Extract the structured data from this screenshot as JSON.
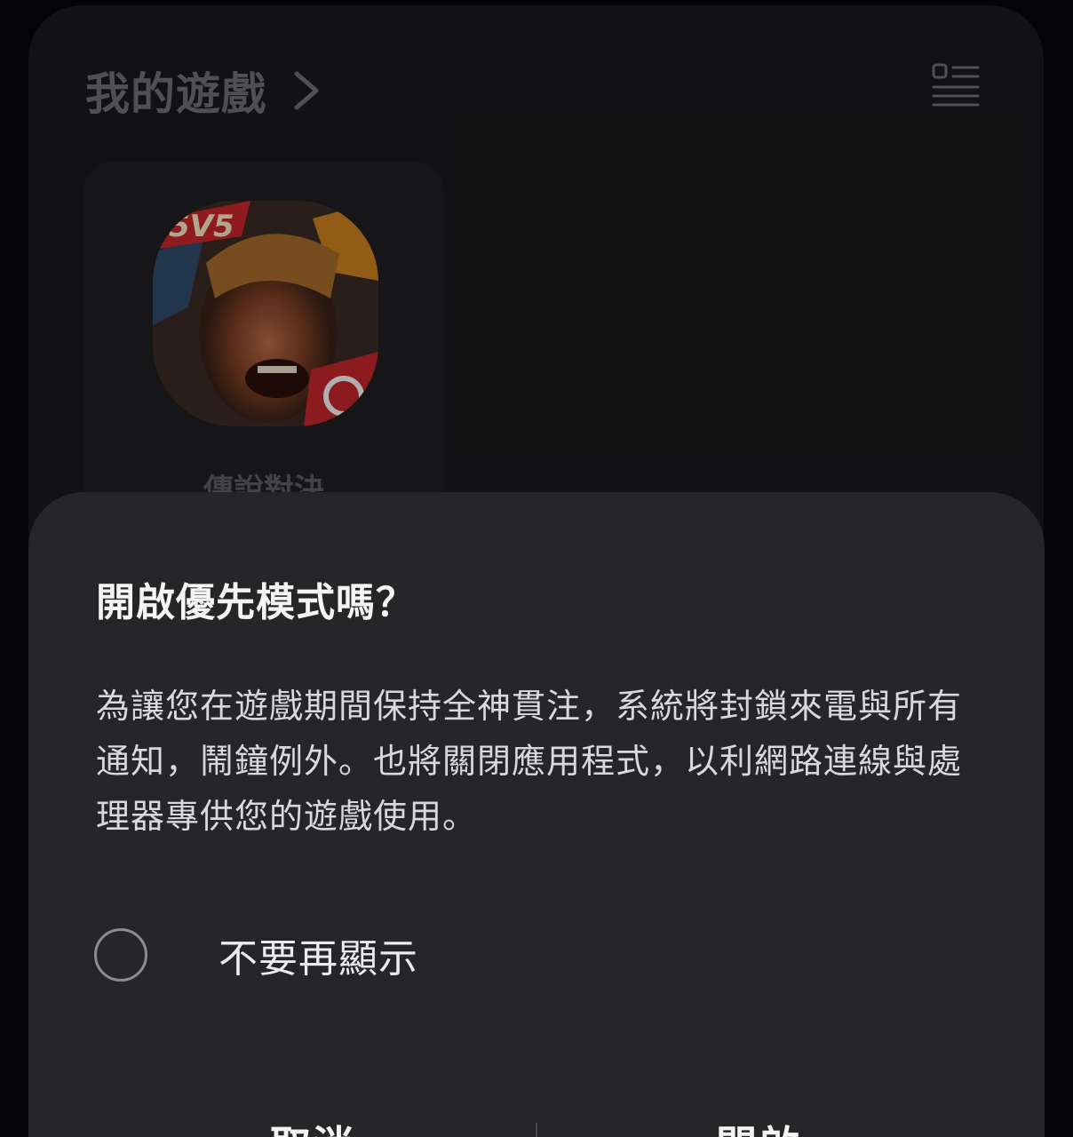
{
  "games_panel": {
    "title": "我的遊戲",
    "chevron_icon": "chevron-right-icon",
    "view_toggle_icon": "list-view-icon",
    "games": [
      {
        "name": "傳說對決",
        "icon": "game-app-icon"
      }
    ]
  },
  "dialog": {
    "title": "開啟優先模式嗎？",
    "body": "為讓您在遊戲期間保持全神貫注，系統將封鎖來電與所有通知，鬧鐘例外。也將關閉應用程式，以利網路連線與處理器專供您的遊戲使用。",
    "checkbox_label": "不要再顯示",
    "checkbox_checked": false,
    "cancel_label": "取消",
    "enable_label": "開啟"
  },
  "colors": {
    "panel_bg": "#1a1a1c",
    "sheet_bg": "#262628",
    "text_primary": "#f4f4f4",
    "text_muted": "#6f6f72"
  }
}
